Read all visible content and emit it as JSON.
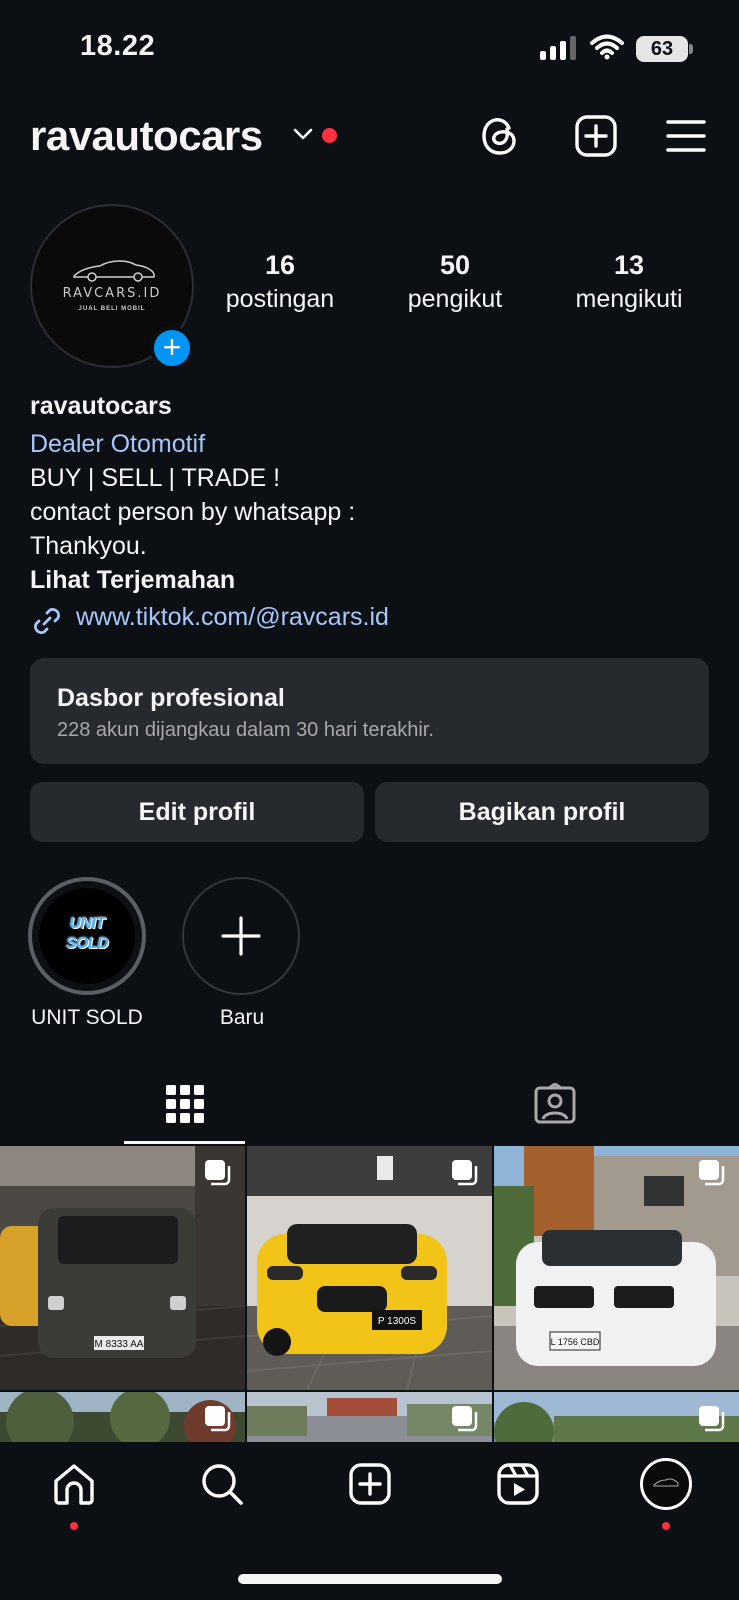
{
  "status": {
    "time": "18.22",
    "battery": "63"
  },
  "header": {
    "username": "ravautocars"
  },
  "avatar": {
    "brand": "RAVCARS.ID",
    "tagline": "JUAL BELI MOBIL"
  },
  "stats": [
    {
      "value": "16",
      "label": "postingan"
    },
    {
      "value": "50",
      "label": "pengikut"
    },
    {
      "value": "13",
      "label": "mengikuti"
    }
  ],
  "bio": {
    "name": "ravautocars",
    "category": "Dealer Otomotif",
    "line1": "BUY | SELL | TRADE !",
    "line2": "contact person by whatsapp :",
    "line3": "Thankyou.",
    "translate": "Lihat Terjemahan",
    "link": "www.tiktok.com/@ravcars.id"
  },
  "dashboard": {
    "title": "Dasbor profesional",
    "subtitle": "228 akun dijangkau dalam 30 hari terakhir."
  },
  "buttons": {
    "edit": "Edit profil",
    "share": "Bagikan profil"
  },
  "highlights": [
    {
      "label": "UNIT SOLD",
      "cover_line1": "UNIT",
      "cover_line2": "SOLD"
    },
    {
      "label": "Baru"
    }
  ],
  "posts": [
    {
      "plate": "M 8333 AA",
      "car_color": "#3b3b38"
    },
    {
      "plate": "P 1300S",
      "car_color": "#f2c418"
    },
    {
      "plate": "L 1756 CBD",
      "car_color": "#f1f1f1"
    }
  ],
  "colors": {
    "accent": "#0095f6",
    "link": "#a8c7fa",
    "notification": "#ff3040",
    "background": "#0c1014"
  },
  "icons": {
    "header": [
      "threads-icon",
      "new-post-icon",
      "menu-icon"
    ],
    "tabs": [
      "grid-icon",
      "tagged-icon"
    ],
    "nav": [
      "home-icon",
      "search-icon",
      "create-icon",
      "reels-icon",
      "profile-icon"
    ]
  }
}
